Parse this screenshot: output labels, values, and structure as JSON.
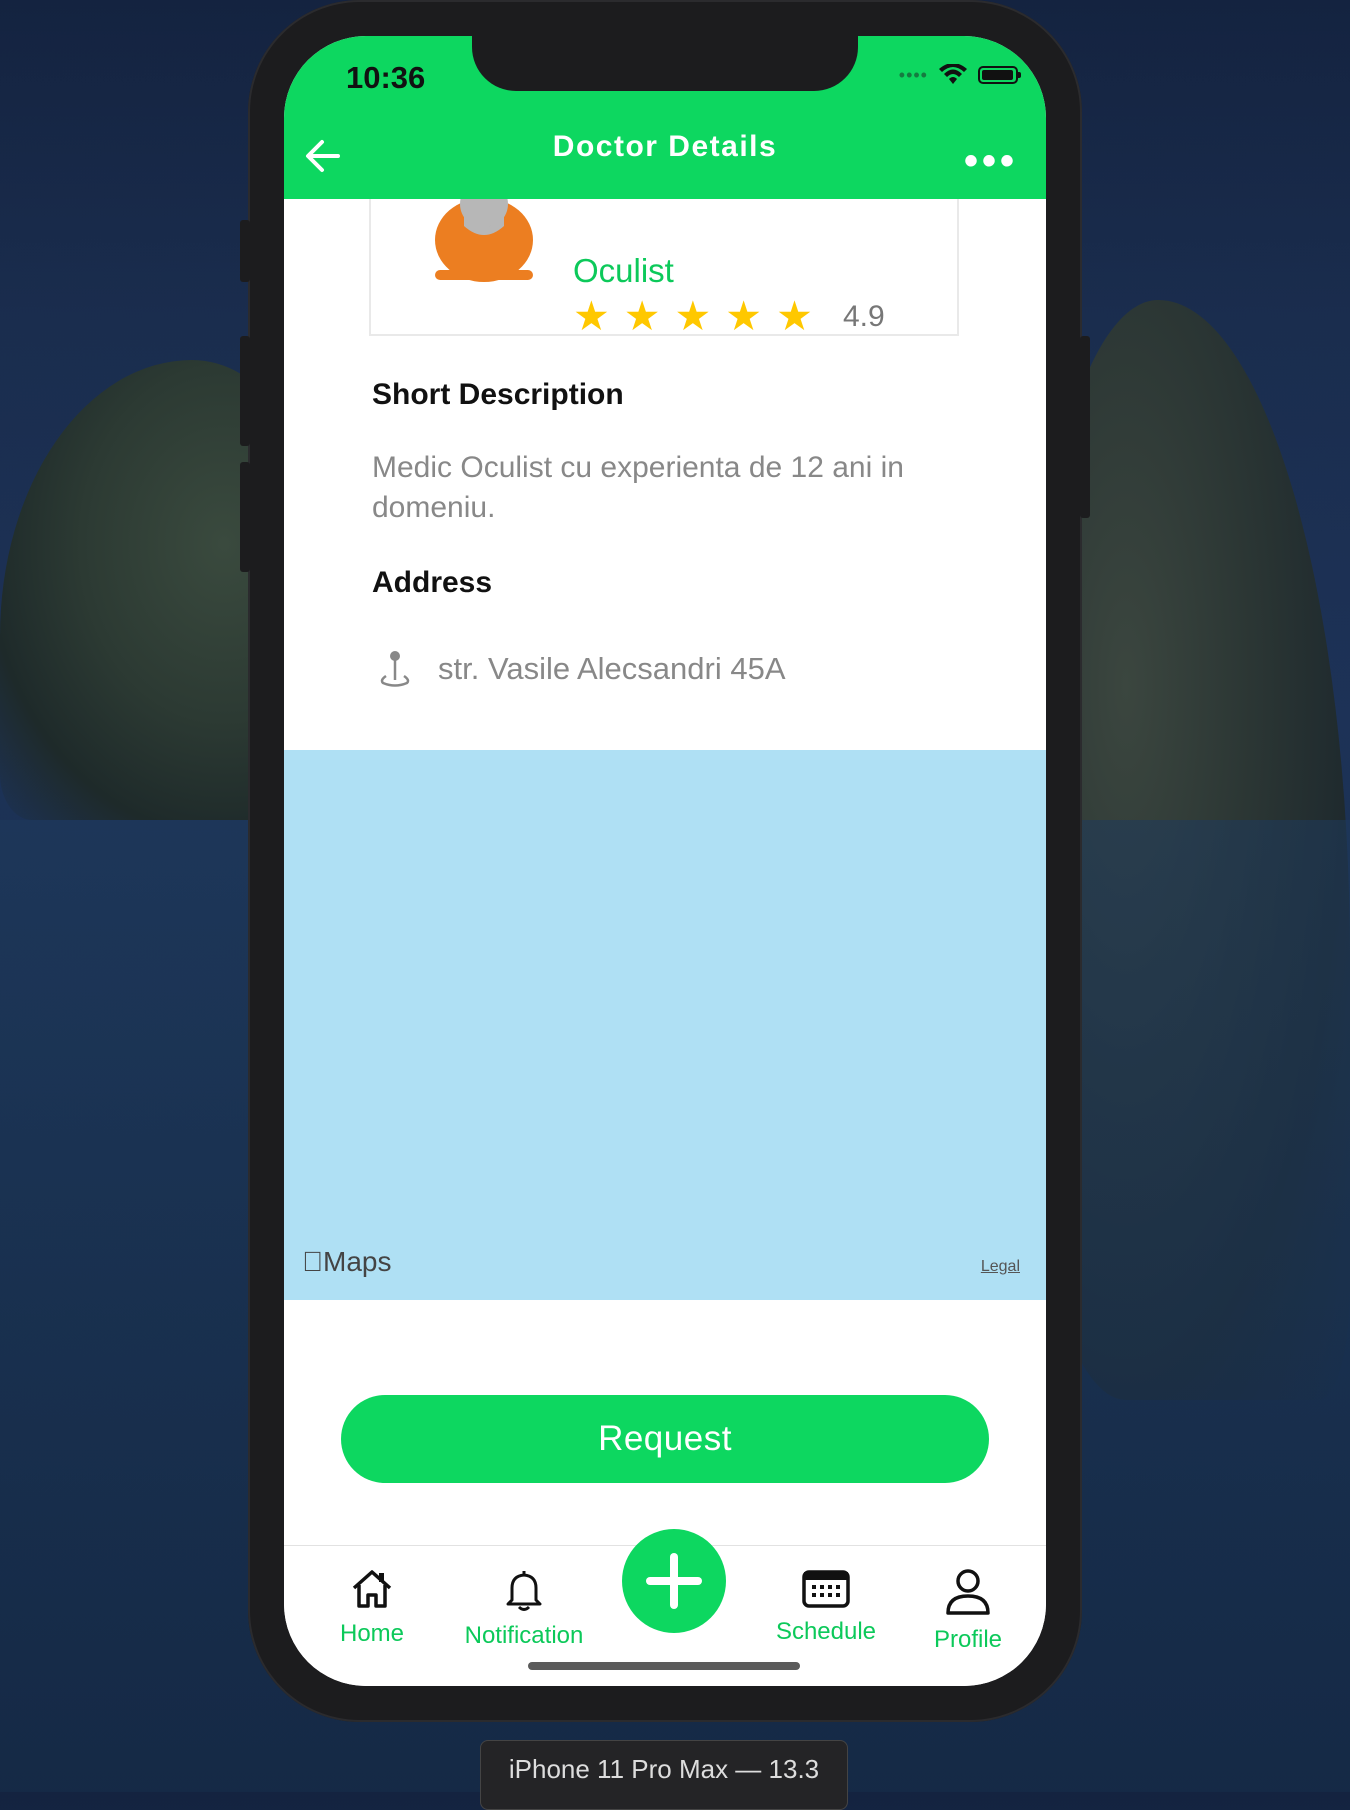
{
  "status_bar": {
    "time": "10:36"
  },
  "header": {
    "title": "Doctor Details",
    "back_icon": "arrow-left-icon",
    "more_icon": "more-horizontal-icon"
  },
  "doctor": {
    "specialty": "Oculist",
    "rating_value": "4.9",
    "stars_filled": 5,
    "stars_total": 5
  },
  "sections": {
    "short_description_title": "Short Description",
    "short_description_text": "Medic Oculist cu experienta de 12 ani in domeniu.",
    "address_title": "Address",
    "address_text": "str. Vasile Alecsandri 45A"
  },
  "map": {
    "logo_text": "Maps",
    "legal_link": "Legal"
  },
  "actions": {
    "request_label": "Request"
  },
  "tabbar": {
    "items": [
      {
        "label": "Home",
        "icon": "home-icon"
      },
      {
        "label": "Notification",
        "icon": "bell-icon"
      },
      {
        "label": "Schedule",
        "icon": "calendar-icon"
      },
      {
        "label": "Profile",
        "icon": "user-icon"
      }
    ],
    "center_action_icon": "plus-icon"
  },
  "simulator": {
    "device_label": "iPhone 11 Pro Max — 13.3"
  },
  "colors": {
    "accent": "#0dd760",
    "star": "#ffc800",
    "map": "#afe0f4"
  }
}
